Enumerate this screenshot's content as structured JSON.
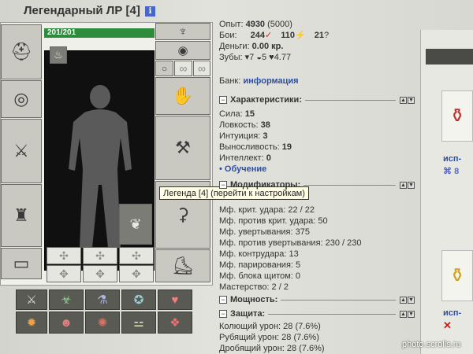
{
  "character": {
    "name": "Легендарный ЛР",
    "level": "[4]",
    "info_icon": "i",
    "hp": "201/201"
  },
  "tooltip": "Легенда [4] (перейти к настройкам)",
  "stats": {
    "exp_label": "Опыт:",
    "exp_value": "4930",
    "exp_next": "(5000)",
    "battles_label": "Бои:",
    "battles_won": "244",
    "battles_lost": "110",
    "battles_draw": "21",
    "money_label": "Деньги:",
    "money_value": "0.00 кр.",
    "teeth_label": "Зубы:",
    "teeth_a": "7",
    "teeth_b": "5",
    "teeth_c": "4.77",
    "bank_label": "Банк:",
    "bank_link": "информация"
  },
  "sections": {
    "characteristics": "Характеристики:",
    "modifiers": "Модификаторы:",
    "power": "Мощность:",
    "defense": "Защита:"
  },
  "characteristics": [
    {
      "label": "Сила:",
      "value": "15"
    },
    {
      "label": "Ловкость:",
      "value": "38"
    },
    {
      "label": "Интуиция:",
      "value": "3"
    },
    {
      "label": "Выносливость:",
      "value": "19"
    },
    {
      "label": "Интеллект:",
      "value": "0"
    }
  ],
  "training_link": "• Обучение",
  "modifiers": [
    "Мф. крит. удара: 22 / 22",
    "Мф. против крит. удара: 50",
    "Мф. увертывания: 375",
    "Мф. против увертывания: 230 / 230",
    "Мф. контрудара: 13",
    "Мф. парирования: 5",
    "Мф. блока щитом: 0",
    "Мастерство: 2 / 2"
  ],
  "defense": [
    "Колющий урон: 28 (7.6%)",
    "Рубящий урон: 28 (7.6%)",
    "Дробящий урон: 28 (7.6%)"
  ],
  "right_panel": {
    "label1": "исп-",
    "label2": "исп-",
    "badge": "8"
  },
  "slot_icons": {
    "helmet": "helmet-icon",
    "bracers": "bracers-icon",
    "weapon": "sword-icon",
    "armor": "armor-icon",
    "belt": "belt-icon",
    "amulet": "amulet-icon",
    "earrings": "earrings-icon",
    "rings": "ring-icon",
    "gloves": "gloves-icon",
    "shield": "axe-icon",
    "legs": "pants-icon",
    "boots": "boots-icon",
    "runes": "rune-icon"
  },
  "watermark": "photo.scrolls.ru",
  "colors": {
    "accent": "#2e4ea0",
    "hp": "#2c8c3c"
  }
}
